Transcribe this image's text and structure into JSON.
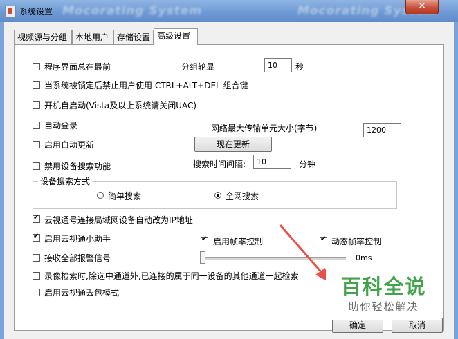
{
  "window": {
    "title": "系统设置",
    "blurred_title": "Mocorating System",
    "close_label": "✕"
  },
  "tabs": [
    {
      "label": "视频源与分组"
    },
    {
      "label": "本地用户"
    },
    {
      "label": "存储设置"
    },
    {
      "label": "高级设置",
      "active": true
    }
  ],
  "options": {
    "always_on_top": {
      "label": "程序界面总在最前",
      "checked": false
    },
    "disable_ctrl_alt_del": {
      "label": "当系统被锁定后禁止用户使用 CTRL+ALT+DEL 组合键",
      "checked": false
    },
    "auto_start": {
      "label": "开机自启动(Vista及以上系统请关闭UAC)",
      "checked": false
    },
    "auto_login": {
      "label": "自动登录",
      "checked": false
    },
    "auto_update": {
      "label": "启用自动更新",
      "checked": false
    },
    "disable_device_search": {
      "label": "禁用设备搜索功能",
      "checked": false
    },
    "auto_ip_change": {
      "label": "云视通号连接局域网设备自动改为IP地址",
      "checked": true
    },
    "assistant": {
      "label": "启用云视通小助手",
      "checked": true
    },
    "receive_alarms": {
      "label": "接收全部报警信号",
      "checked": false
    },
    "record_search": {
      "label": "录像检索时,除选中通道外,已连接的属于同一设备的其他通道一起检索",
      "checked": false
    },
    "packet_loss_mode": {
      "label": "启用云视通丢包模式",
      "checked": false
    }
  },
  "group_rotation": {
    "label": "分组轮显",
    "value": "10",
    "unit": "秒"
  },
  "mtu": {
    "label": "网络最大传输单元大小(字节)",
    "value": "1200"
  },
  "update_now": {
    "label": "现在更新"
  },
  "search_interval": {
    "label": "搜索时间间隔:",
    "value": "10",
    "unit": "分钟"
  },
  "search_mode": {
    "title": "设备搜索方式",
    "options": [
      {
        "label": "简单搜索",
        "selected": false
      },
      {
        "label": "全网搜索",
        "selected": true
      }
    ]
  },
  "frame_rate": {
    "enable": {
      "label": "启用帧率控制",
      "checked": true
    },
    "dynamic": {
      "label": "动态帧率控制",
      "checked": true
    },
    "slider_value": "0ms",
    "slider_level": 0
  },
  "footer": {
    "ok_label": "确定",
    "cancel_label": "取消"
  },
  "watermark": {
    "title": "百科全说",
    "subtitle": "助你轻松解决"
  },
  "colors": {
    "titlebar": "#6e9ad4",
    "close": "#c7503a",
    "watermark_green": "#41a34a",
    "arrow": "#e8524a"
  }
}
